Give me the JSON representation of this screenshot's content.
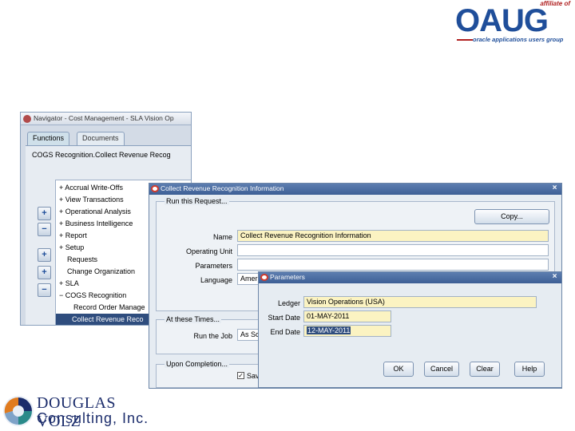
{
  "oaug": {
    "affiliate": "affiliate of",
    "name": "OAUG",
    "tagline": "oracle applications users group"
  },
  "douglas_volz": {
    "line1": "DOUGLAS VOLZ",
    "line2": "Consulting, Inc."
  },
  "navigator": {
    "title": "Navigator - Cost Management - SLA Vision Op",
    "tabs": [
      "Functions",
      "Documents"
    ],
    "path": "COGS Recognition.Collect Revenue Recog",
    "side_buttons": [
      "+",
      "−",
      "+",
      "+",
      "−"
    ],
    "tree_items": [
      {
        "prefix": "+",
        "label": "Accrual Write-Offs"
      },
      {
        "prefix": "+",
        "label": "View Transactions"
      },
      {
        "prefix": "+",
        "label": "Operational Analysis"
      },
      {
        "prefix": "+",
        "label": "Business Intelligence"
      },
      {
        "prefix": "+",
        "label": "Report"
      },
      {
        "prefix": "+",
        "label": "Setup"
      },
      {
        "prefix": "",
        "label": "Requests"
      },
      {
        "prefix": "",
        "label": "Change Organization"
      },
      {
        "prefix": "+",
        "label": "SLA"
      },
      {
        "prefix": "−",
        "label": "COGS Recognition"
      },
      {
        "prefix": "",
        "label": "Record Order Manage"
      },
      {
        "prefix": "",
        "label": "Collect Revenue Reco"
      }
    ]
  },
  "collect": {
    "title": "Collect Revenue Recognition Information",
    "run_group": "Run this Request...",
    "copy_button": "Copy...",
    "name_label": "Name",
    "name_value": "Collect Revenue Recognition Information",
    "op_unit_label": "Operating Unit",
    "op_unit_value": "",
    "params_label": "Parameters",
    "params_value": "",
    "language_label": "Language",
    "language_value": "Ameri",
    "times_group": "At these Times...",
    "run_job_label": "Run the Job",
    "run_job_value": "As Sc",
    "completion_group": "Upon Completion...",
    "save_label": "Sav"
  },
  "parameters": {
    "title": "Parameters",
    "ledger_label": "Ledger",
    "ledger_value": "Vision Operations (USA)",
    "start_label": "Start Date",
    "start_value": "01-MAY-2011",
    "end_label": "End Date",
    "end_value": "12-MAY-2011",
    "buttons": {
      "ok": "OK",
      "cancel": "Cancel",
      "clear": "Clear",
      "help": "Help"
    }
  }
}
